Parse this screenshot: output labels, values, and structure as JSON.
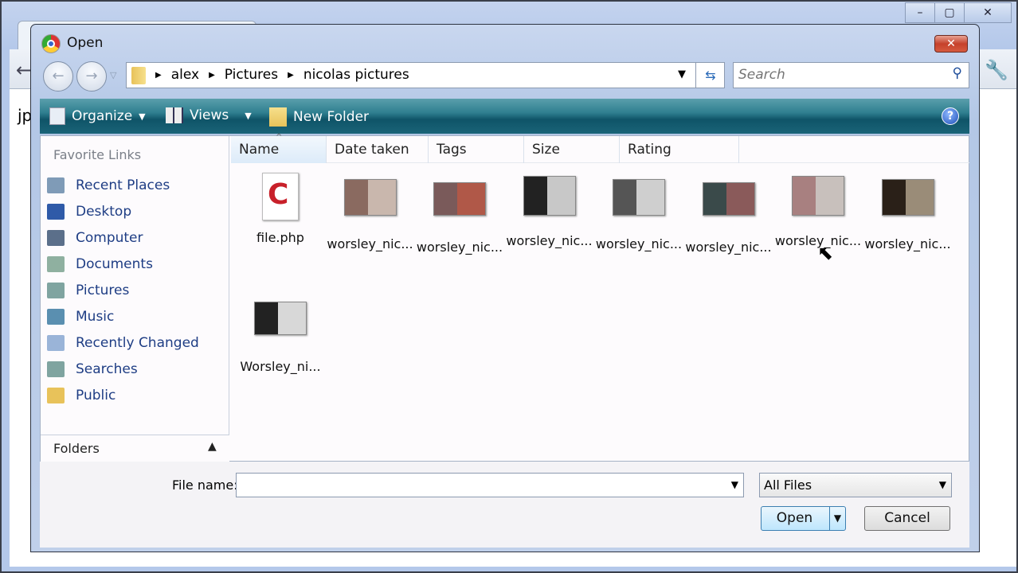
{
  "browser": {
    "page_text": "jp"
  },
  "dialog": {
    "title": "Open",
    "address": {
      "crumbs": [
        "alex",
        "Pictures",
        "nicolas pictures"
      ]
    },
    "search": {
      "placeholder": "Search"
    },
    "toolbar": {
      "organize": "Organize",
      "views": "Views",
      "new_folder": "New Folder"
    },
    "sidebar": {
      "title": "Favorite Links",
      "links": [
        {
          "label": "Recent Places",
          "color": "#7f9bb7"
        },
        {
          "label": "Desktop",
          "color": "#2f5aa8"
        },
        {
          "label": "Computer",
          "color": "#5b6f8a"
        },
        {
          "label": "Documents",
          "color": "#8fb0a0"
        },
        {
          "label": "Pictures",
          "color": "#7fa4a0"
        },
        {
          "label": "Music",
          "color": "#5a8fb0"
        },
        {
          "label": "Recently Changed",
          "color": "#9ab4d8"
        },
        {
          "label": "Searches",
          "color": "#7fa4a0"
        },
        {
          "label": "Public",
          "color": "#e8c25a"
        }
      ],
      "folders": "Folders"
    },
    "columns": [
      "Name",
      "Date taken",
      "Tags",
      "Size",
      "Rating"
    ],
    "files": [
      {
        "name": "file.php",
        "type": "php"
      },
      {
        "name": "worsley_nic...",
        "colors": [
          "#8a6a60",
          "#c9b7ad"
        ]
      },
      {
        "name": "worsley_nic...",
        "colors": [
          "#7a5a5a",
          "#b05848"
        ]
      },
      {
        "name": "worsley_nic...",
        "colors": [
          "#222",
          "#c8c8c8"
        ]
      },
      {
        "name": "worsley_nic...",
        "colors": [
          "#555",
          "#cfcfcf"
        ]
      },
      {
        "name": "worsley_nic...",
        "colors": [
          "#3a4a4a",
          "#8a5a5a"
        ]
      },
      {
        "name": "worsley_nic...",
        "colors": [
          "#a88080",
          "#c8c0bc"
        ]
      },
      {
        "name": "worsley_nic...",
        "colors": [
          "#2a2018",
          "#9a8c78"
        ]
      },
      {
        "name": "Worsley_ni...",
        "colors": [
          "#222",
          "#d8d8d8"
        ]
      }
    ],
    "bottom": {
      "file_name_label": "File name:",
      "file_name_value": "",
      "filter": "All Files",
      "open": "Open",
      "cancel": "Cancel"
    }
  }
}
